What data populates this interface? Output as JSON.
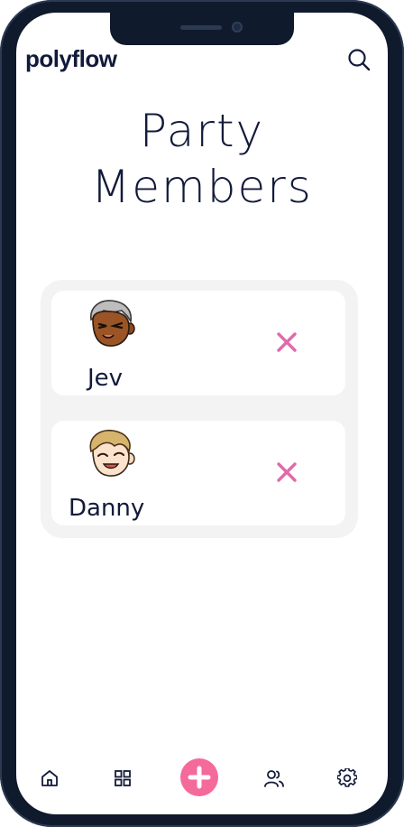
{
  "app": {
    "brand": "polyflow"
  },
  "page": {
    "title_line1": "Party",
    "title_line2": "Members"
  },
  "members": [
    {
      "name": "Jev",
      "avatar": "jev-avatar",
      "remove_icon": "close-icon"
    },
    {
      "name": "Danny",
      "avatar": "danny-avatar",
      "remove_icon": "close-icon"
    }
  ],
  "header": {
    "search_icon": "search-icon"
  },
  "nav": {
    "items": [
      {
        "icon": "home-icon"
      },
      {
        "icon": "grid-icon"
      },
      {
        "icon": "plus-icon"
      },
      {
        "icon": "users-icon"
      },
      {
        "icon": "settings-icon"
      }
    ]
  },
  "colors": {
    "text": "#121a3a",
    "accent": "#f46a9b",
    "remove": "#e06aa8",
    "card_bg": "#f3f3f3",
    "frame": "#0f1a2c"
  }
}
